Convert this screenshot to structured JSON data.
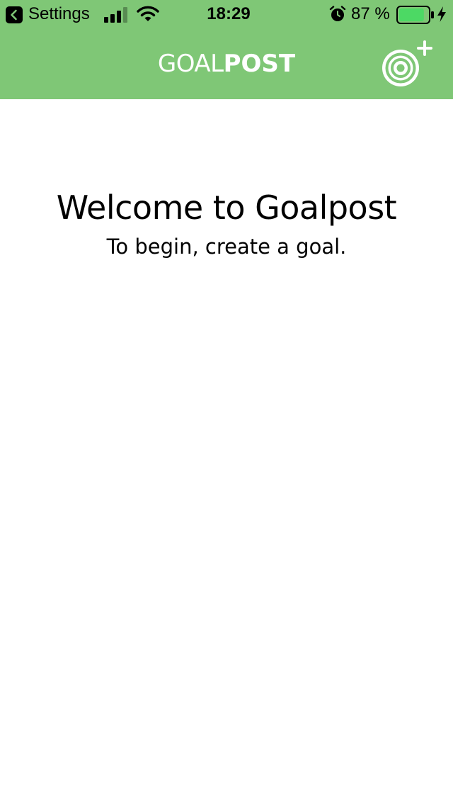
{
  "status_bar": {
    "back_label": "Settings",
    "time": "18:29",
    "battery_percent": "87 %",
    "battery_level": 0.87,
    "battery_color": "#4cd964",
    "signal_icon": "cellular-signal-icon",
    "wifi_icon": "wifi-icon",
    "alarm_icon": "alarm-icon",
    "charging_icon": "charging-bolt-icon"
  },
  "header": {
    "title_light": "GOAL",
    "title_bold": "POST",
    "background_color": "#7fc776",
    "add_goal_icon": "target-plus-icon"
  },
  "main": {
    "welcome": "Welcome to Goalpost",
    "subtitle": "To begin, create a goal."
  }
}
